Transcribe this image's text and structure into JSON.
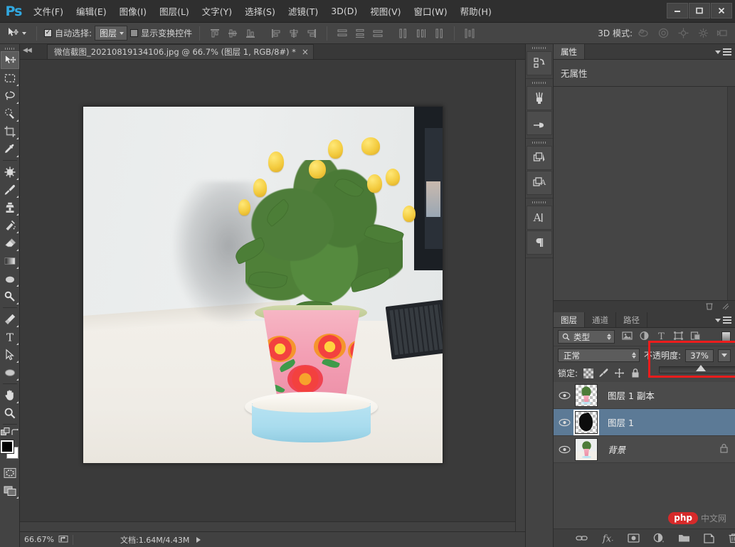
{
  "app": {
    "logo_text": "Ps",
    "title_controls": {
      "minimize": "–",
      "maximize": "□",
      "close": "×"
    }
  },
  "menubar": {
    "items": [
      {
        "label": "文件(F)",
        "name": "menu-file"
      },
      {
        "label": "编辑(E)",
        "name": "menu-edit"
      },
      {
        "label": "图像(I)",
        "name": "menu-image"
      },
      {
        "label": "图层(L)",
        "name": "menu-layer"
      },
      {
        "label": "文字(Y)",
        "name": "menu-type"
      },
      {
        "label": "选择(S)",
        "name": "menu-select"
      },
      {
        "label": "滤镜(T)",
        "name": "menu-filter"
      },
      {
        "label": "3D(D)",
        "name": "menu-3d"
      },
      {
        "label": "视图(V)",
        "name": "menu-view"
      },
      {
        "label": "窗口(W)",
        "name": "menu-window"
      },
      {
        "label": "帮助(H)",
        "name": "menu-help"
      }
    ]
  },
  "options_bar": {
    "auto_select_label": "自动选择:",
    "auto_select_checked": true,
    "auto_select_value": "图层",
    "show_transform_label": "显示变换控件",
    "show_transform_checked": false,
    "mode_3d_label": "3D 模式:"
  },
  "toolbar": {
    "tools": [
      {
        "name": "move-tool",
        "label": "移动工具",
        "active": true
      },
      {
        "name": "marquee-tool",
        "label": "矩形选框工具",
        "active": false
      },
      {
        "name": "lasso-tool",
        "label": "套索工具",
        "active": false
      },
      {
        "name": "quick-selection-tool",
        "label": "快速选择工具",
        "active": false
      },
      {
        "name": "crop-tool",
        "label": "裁剪工具",
        "active": false
      },
      {
        "name": "eyedropper-tool",
        "label": "吸管工具",
        "active": false
      },
      {
        "name": "spot-healing-brush-tool",
        "label": "污点修复画笔工具",
        "active": false
      },
      {
        "name": "brush-tool",
        "label": "画笔工具",
        "active": false
      },
      {
        "name": "clone-stamp-tool",
        "label": "仿制图章工具",
        "active": false
      },
      {
        "name": "history-brush-tool",
        "label": "历史记录画笔工具",
        "active": false
      },
      {
        "name": "eraser-tool",
        "label": "橡皮擦工具",
        "active": false
      },
      {
        "name": "gradient-tool",
        "label": "渐变工具",
        "active": false
      },
      {
        "name": "blur-tool",
        "label": "模糊工具",
        "active": false
      },
      {
        "name": "dodge-tool",
        "label": "减淡工具",
        "active": false
      },
      {
        "name": "pen-tool",
        "label": "钢笔工具",
        "active": false
      },
      {
        "name": "type-tool",
        "label": "横排文字工具",
        "active": false
      },
      {
        "name": "path-selection-tool",
        "label": "路径选择工具",
        "active": false
      },
      {
        "name": "ellipse-tool",
        "label": "椭圆工具",
        "active": false
      },
      {
        "name": "hand-tool",
        "label": "抓手工具",
        "active": false
      },
      {
        "name": "zoom-tool",
        "label": "缩放工具",
        "active": false
      }
    ],
    "foreground_color": "#000000",
    "background_color": "#ffffff"
  },
  "document": {
    "tab_title": "微信截图_20210819134106.jpg @ 66.7% (图层 1, RGB/8#) *",
    "close_label": "×"
  },
  "status_bar": {
    "zoom": "66.67%",
    "doc_info": "文档:1.64M/4.43M"
  },
  "properties_panel": {
    "tab_label": "属性",
    "empty_text": "无属性"
  },
  "layers_panel": {
    "tabs": [
      {
        "label": "图层",
        "active": true,
        "name": "tab-layers"
      },
      {
        "label": "通道",
        "active": false,
        "name": "tab-channels"
      },
      {
        "label": "路径",
        "active": false,
        "name": "tab-paths"
      }
    ],
    "filter_kind_label": "类型",
    "blend_mode": "正常",
    "opacity_label": "不透明度:",
    "opacity_value": "37%",
    "opacity_percent": 37,
    "lock_label": "锁定:",
    "highlight_color": "#ee1c1c",
    "layers": [
      {
        "name": "图层 1 副本",
        "visible": true,
        "selected": false,
        "locked": false,
        "kind": "copy"
      },
      {
        "name": "图层 1",
        "visible": true,
        "selected": true,
        "locked": false,
        "kind": "mask"
      },
      {
        "name": "背景",
        "visible": true,
        "selected": false,
        "locked": true,
        "kind": "background"
      }
    ],
    "footer_buttons": [
      {
        "name": "link-layers-icon",
        "label": "链接图层"
      },
      {
        "name": "layer-style-fx-icon",
        "label": "添加图层样式"
      },
      {
        "name": "add-layer-mask-icon",
        "label": "添加图层蒙版"
      },
      {
        "name": "new-adjustment-layer-icon",
        "label": "创建新的填充或调整图层"
      },
      {
        "name": "new-group-icon",
        "label": "创建新组"
      },
      {
        "name": "new-layer-icon",
        "label": "创建新图层"
      },
      {
        "name": "delete-layer-icon",
        "label": "删除图层"
      }
    ]
  },
  "icon_rail": {
    "buttons": [
      {
        "name": "history-icon",
        "label": "历史记录"
      },
      {
        "name": "brush-presets-icon",
        "label": "画笔预设"
      },
      {
        "name": "brush-panel-icon",
        "label": "画笔"
      },
      {
        "name": "layer-comps-icon",
        "label": "图层复合"
      },
      {
        "name": "adjustments-icon",
        "label": "调整"
      },
      {
        "name": "character-icon",
        "label": "字符"
      },
      {
        "name": "paragraph-icon",
        "label": "段落"
      }
    ]
  },
  "watermark": {
    "badge": "php",
    "text": "中文网"
  }
}
